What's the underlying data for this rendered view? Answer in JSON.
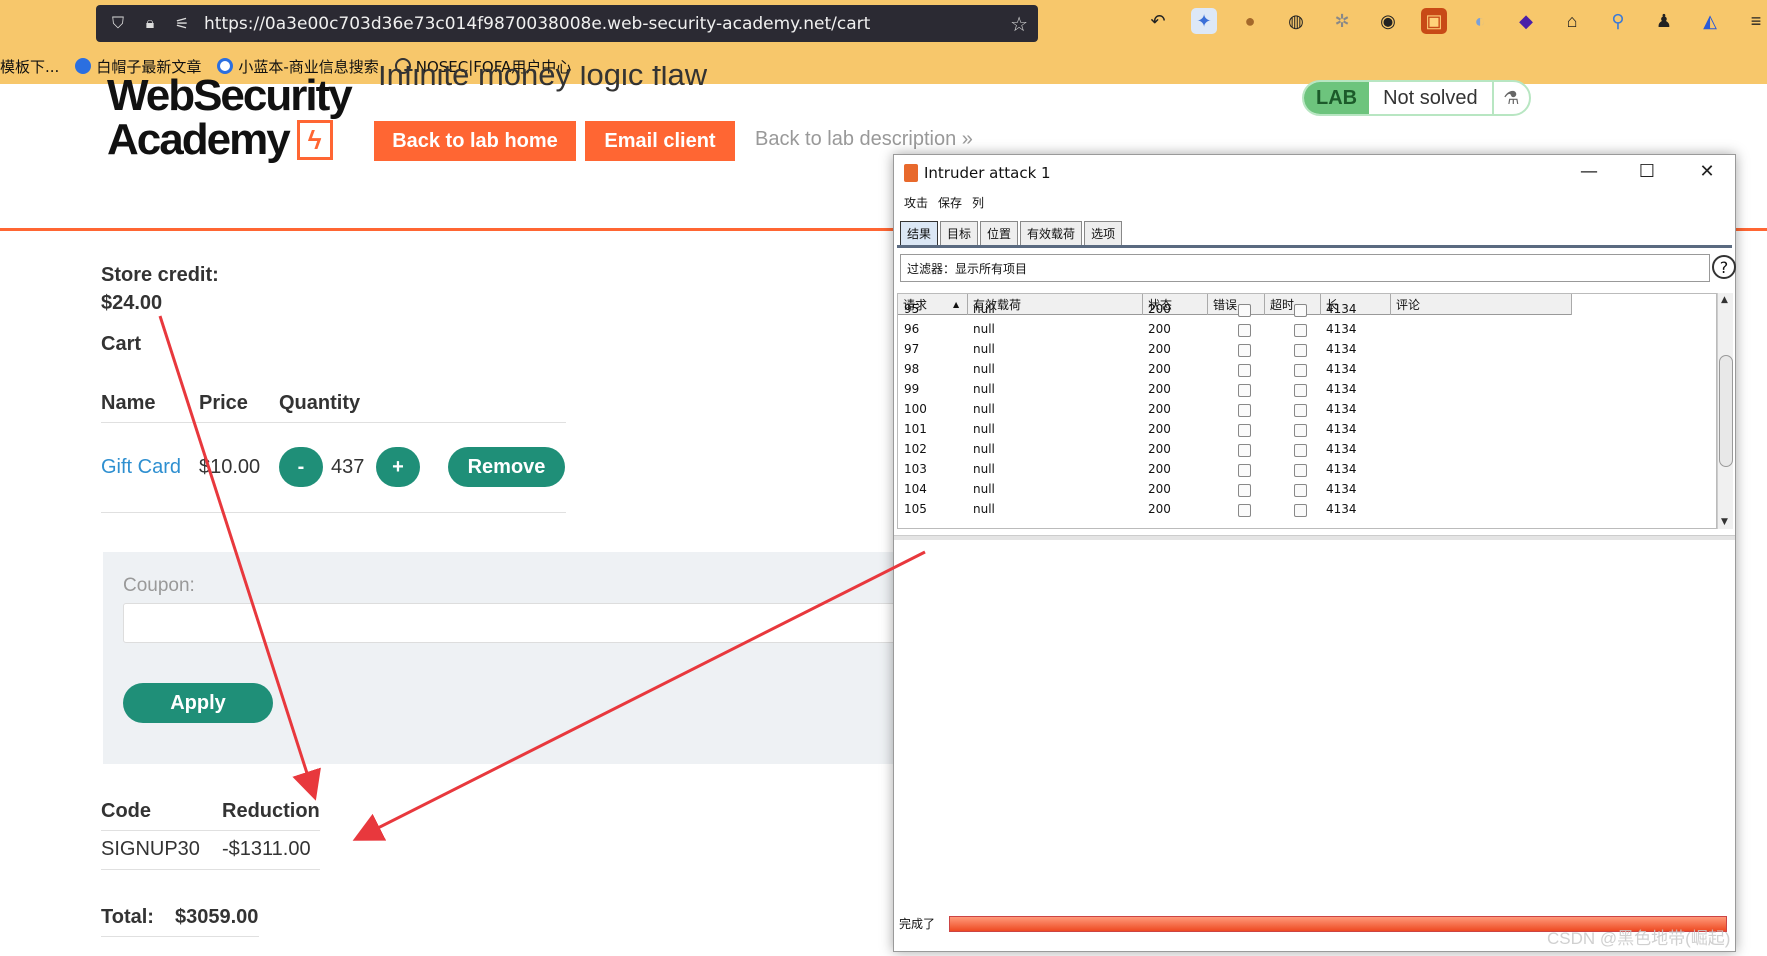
{
  "browser": {
    "url": "https://0a3e00c703d36e73c014f9870038008e.web-security-academy.net/cart",
    "bookmarks": [
      "模板下...",
      "白帽子最新文章",
      "小蓝本-商业信息搜索",
      "NOSEC|FOFA用户中心"
    ]
  },
  "header": {
    "logo_line1": "WebSecurity",
    "logo_line2": "Academy",
    "logo_bolt": "ϟ",
    "lab_title": "Infinite money logic flaw",
    "back_home": "Back to lab home",
    "email_client": "Email client",
    "back_desc": "Back to lab description",
    "back_desc_chevron": "»",
    "lab_badge": "LAB",
    "lab_status": "Not solved",
    "flask_icon": "⚗"
  },
  "cart": {
    "store_credit_label": "Store credit:",
    "store_credit_value": "$24.00",
    "cart_heading": "Cart",
    "columns": [
      "Name",
      "Price",
      "Quantity"
    ],
    "item": {
      "name": "Gift Card",
      "price": "$10.00",
      "minus": "-",
      "quantity": "437",
      "plus": "+",
      "remove": "Remove"
    },
    "coupon_label": "Coupon:",
    "apply": "Apply",
    "code_header": "Code",
    "reduction_header": "Reduction",
    "code": "SIGNUP30",
    "reduction": "-$1311.00",
    "total_label": "Total:",
    "total_value": "$3059.00"
  },
  "intruder": {
    "title": "Intruder attack 1",
    "controls": {
      "minimize": "—",
      "maximize": "☐",
      "close": "✕"
    },
    "menu": [
      "攻击",
      "保存",
      "列"
    ],
    "tabs": [
      "结果",
      "目标",
      "位置",
      "有效载荷",
      "选项"
    ],
    "filter": "过滤器：显示所有项目",
    "help": "?",
    "columns": [
      "请求",
      "有效载荷",
      "状态",
      "错误",
      "超时",
      "长",
      "评论"
    ],
    "sort_indicator": "▲",
    "rows": [
      {
        "req": "95",
        "payload": "null",
        "status": "200",
        "len": "4134"
      },
      {
        "req": "96",
        "payload": "null",
        "status": "200",
        "len": "4134"
      },
      {
        "req": "97",
        "payload": "null",
        "status": "200",
        "len": "4134"
      },
      {
        "req": "98",
        "payload": "null",
        "status": "200",
        "len": "4134"
      },
      {
        "req": "99",
        "payload": "null",
        "status": "200",
        "len": "4134"
      },
      {
        "req": "100",
        "payload": "null",
        "status": "200",
        "len": "4134"
      },
      {
        "req": "101",
        "payload": "null",
        "status": "200",
        "len": "4134"
      },
      {
        "req": "102",
        "payload": "null",
        "status": "200",
        "len": "4134"
      },
      {
        "req": "103",
        "payload": "null",
        "status": "200",
        "len": "4134"
      },
      {
        "req": "104",
        "payload": "null",
        "status": "200",
        "len": "4134"
      },
      {
        "req": "105",
        "payload": "null",
        "status": "200",
        "len": "4134"
      }
    ],
    "status_text": "完成了",
    "progress": 1.0
  },
  "watermark": "CSDN @黑色地带(崛起)",
  "colors": {
    "accent": "#ff6633",
    "green": "#1f8f78",
    "arrow": "#e8383d"
  }
}
